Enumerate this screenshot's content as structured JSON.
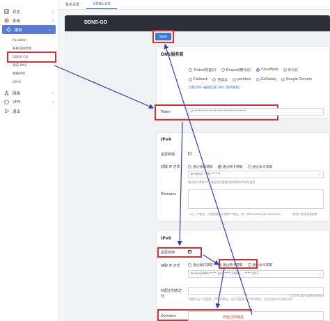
{
  "sidebar": {
    "items": [
      {
        "label": "状态",
        "icon": "status-icon"
      },
      {
        "label": "系统",
        "icon": "gear-icon"
      },
      {
        "label": "服务",
        "icon": "services-icon",
        "active": true
      }
    ],
    "sub_items": [
      "PassWall",
      "系统在线更新",
      "DDNS-GO",
      "动态 DNS",
      "网络共享",
      "UPnP"
    ],
    "items_after": [
      {
        "label": "网络",
        "icon": "network-icon"
      },
      {
        "label": "VPN",
        "icon": "vpn-icon"
      },
      {
        "label": "退出",
        "icon": "logout-icon"
      }
    ]
  },
  "tabs": [
    {
      "label": "基本设置"
    },
    {
      "label": "DDNS-GO",
      "active": true
    }
  ],
  "header": {
    "title": "DDNS-GO"
  },
  "save_label": "Save",
  "dns_card": {
    "title": "DNS服务商",
    "providers": [
      "Alidns(阿里云)",
      "Dnspod(腾讯云)",
      "Cloudflare",
      "华为云",
      "Callback",
      "百度云",
      "porkbun",
      "GoDaddy",
      "Google Domain"
    ],
    "selected": "Cloudflare",
    "create_link": "创建令牌→编辑区域 DNS (使用模板)",
    "token_label": "Token",
    "token_value": "a**********************************"
  },
  "ipv4_card": {
    "title": "IPv4",
    "enable_label": "是否启用",
    "enabled": false,
    "method_label": "获取 IP 方式",
    "methods": [
      "通过接口获取",
      "通过网卡获取",
      "通过命令获取"
    ],
    "selected_method": "通过网卡获取",
    "interface_value": "br-lan(1 *.*8.*****)",
    "interface_hint": "通过网卡获取 IP，通过首页查看目前获取的IP地址使用",
    "domains_label": "Domains",
    "domains_hint": "一行一个域名，可使用冒号分隔多个域名，如：ddns.example.com:zone",
    "domains_link": "多用户多域名请参考"
  },
  "ipv6_card": {
    "title": "IPv6",
    "enable_label": "是否启用",
    "enabled": true,
    "method_label": "获取 IP 方式",
    "methods": [
      "通过接口获取",
      "通过网卡获取",
      "通过命令获取"
    ],
    "selected_method": "通过网卡获取",
    "interface_value": "br-lan(240e:**** 1a2:****:240e:...  ****:10:1",
    "regex_label": "匹配正则表达式",
    "regex_hint": "可使用 @1 匹配第一个IPv6地址，@2 匹配第二个IPv6地址，也可自定义正则表达式",
    "domains_label": "Domains",
    "domains_annotation": "你自己的域名"
  },
  "watermark": "CSDN @ongleewikje"
}
